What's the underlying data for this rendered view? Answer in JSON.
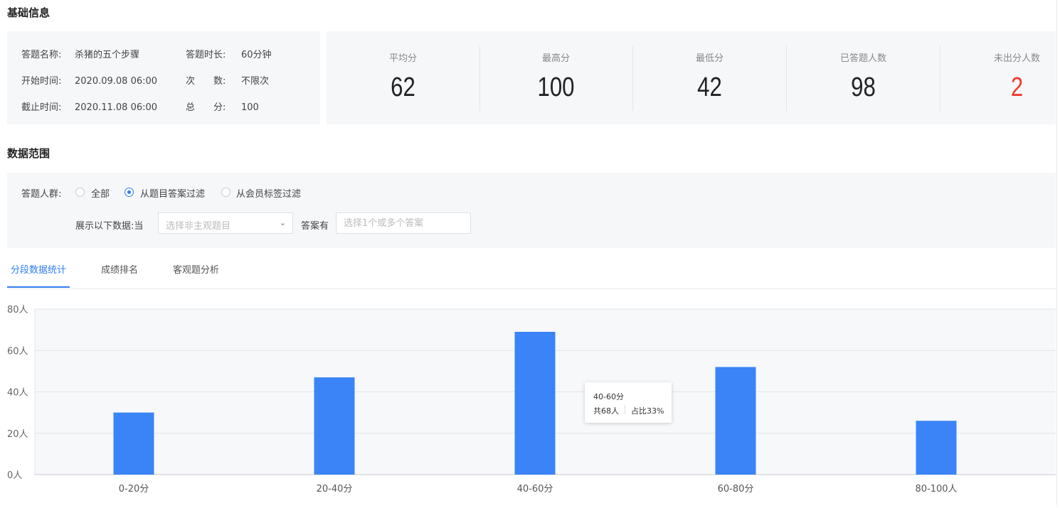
{
  "basic": {
    "title": "基础信息",
    "fields": [
      {
        "label": "答题名称:",
        "value": "杀猪的五个步骤"
      },
      {
        "label": "开始时间:",
        "value": "2020.09.08 06:00"
      },
      {
        "label": "截止时间:",
        "value": "2020.11.08 06:00"
      },
      {
        "label": "答题时长:",
        "value": "60分钟"
      },
      {
        "label": "次　　数:",
        "value": "不限次"
      },
      {
        "label": "总　　分:",
        "value": "100"
      }
    ]
  },
  "stats": [
    {
      "label": "平均分",
      "value": "62"
    },
    {
      "label": "最高分",
      "value": "100"
    },
    {
      "label": "最低分",
      "value": "42"
    },
    {
      "label": "已答题人数",
      "value": "98"
    },
    {
      "label": "未出分人数",
      "value": "2"
    }
  ],
  "stats_highlight_color": "#f0392b",
  "range": {
    "title": "数据范围",
    "group_label": "答题人群:",
    "options": [
      "全部",
      "从题目答案过滤",
      "从会员标签过滤"
    ],
    "selected_option": "从题目答案过滤",
    "show_label": "展示以下数据:当",
    "question_select_placeholder": "选择非主观题目",
    "answer_label": "答案有",
    "answer_placeholder": "选择1个或多个答案"
  },
  "tabs": [
    "分段数据统计",
    "成绩排名",
    "客观题分析"
  ],
  "active_tab": "分段数据统计",
  "accent_color": "#2f7cf6",
  "chart_data": {
    "type": "bar",
    "categories": [
      "0-20分",
      "20-40分",
      "40-60分",
      "60-80分",
      "80-100人"
    ],
    "values": [
      30,
      47,
      69,
      52,
      26
    ],
    "ylim": [
      0,
      80
    ],
    "y_ticks": [
      "0人",
      "20人",
      "40人",
      "60人",
      "80人"
    ],
    "bar_color": "#3a84f8",
    "grid": true,
    "tooltip": {
      "title": "40-60分",
      "count": "共68人",
      "ratio": "占比33%"
    }
  }
}
